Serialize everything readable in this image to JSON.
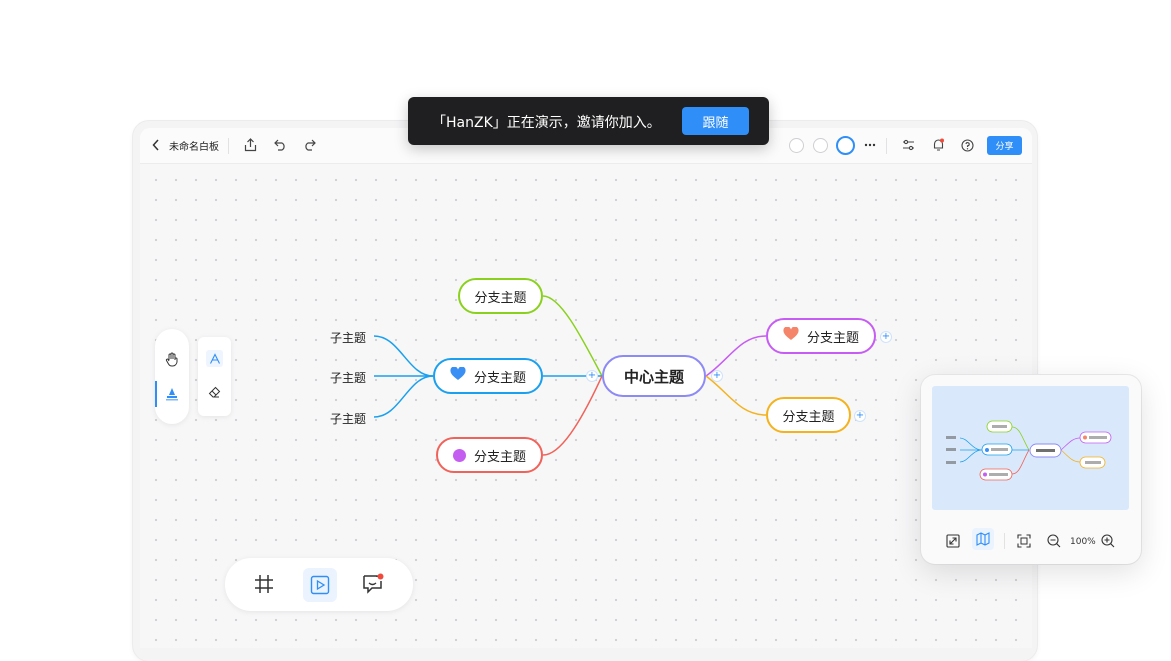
{
  "banner": {
    "message": "「HanZK」正在演示，邀请你加入。",
    "follow_label": "跟随"
  },
  "toolbar": {
    "title": "未命名白板",
    "share_label": "分享"
  },
  "mindmap": {
    "center": "中心主题",
    "left_branches": [
      {
        "label": "分支主题",
        "color": "#8ad11e"
      },
      {
        "label": "分支主题",
        "color": "#1aa0ee",
        "marker": "heart-icon",
        "marker_color": "#3a8ff5"
      },
      {
        "label": "分支主题",
        "color": "#f0625a",
        "marker": "dot-icon",
        "marker_color": "#c45ef0"
      }
    ],
    "right_branches": [
      {
        "label": "分支主题",
        "color": "#c65cf3",
        "marker": "heart-icon",
        "marker_color": "#f5856a"
      },
      {
        "label": "分支主题",
        "color": "#f4b21d"
      }
    ],
    "subtopics": [
      "子主题",
      "子主题",
      "子主题"
    ],
    "center_color": "#8d8af5"
  },
  "minimap": {
    "zoom": "100%"
  }
}
